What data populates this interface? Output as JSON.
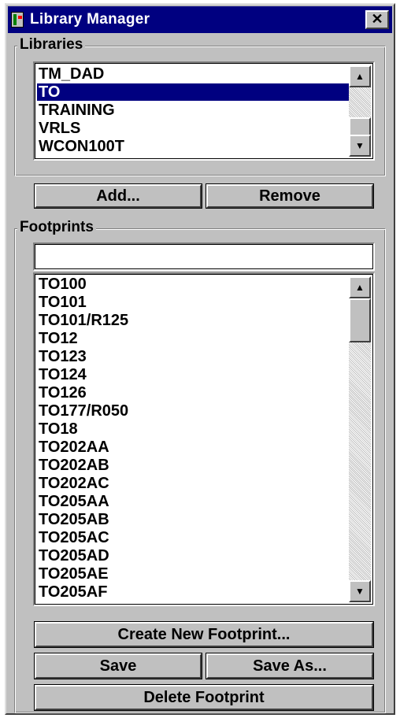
{
  "window": {
    "title": "Library Manager",
    "close_glyph": "✕",
    "icon": "library-manager-app-icon"
  },
  "libraries": {
    "group_label": "Libraries",
    "items": [
      "TM_DAD",
      "TO",
      "TRAINING",
      "VRLS",
      "WCON100T"
    ],
    "selected_index": 1,
    "add_label": "Add...",
    "remove_label": "Remove"
  },
  "footprints": {
    "group_label": "Footprints",
    "filter_value": "",
    "items": [
      "TO100",
      "TO101",
      "TO101/R125",
      "TO12",
      "TO123",
      "TO124",
      "TO126",
      "TO177/R050",
      "TO18",
      "TO202AA",
      "TO202AB",
      "TO202AC",
      "TO205AA",
      "TO205AB",
      "TO205AC",
      "TO205AD",
      "TO205AE",
      "TO205AF"
    ],
    "create_label": "Create New Footprint...",
    "save_label": "Save",
    "save_as_label": "Save As...",
    "delete_label": "Delete Footprint"
  },
  "scroll_glyphs": {
    "up": "▲",
    "down": "▼"
  },
  "colors": {
    "face": "#c0c0c0",
    "title_bar": "#000080",
    "selection": "#000080",
    "list_bg": "#ffffff"
  }
}
